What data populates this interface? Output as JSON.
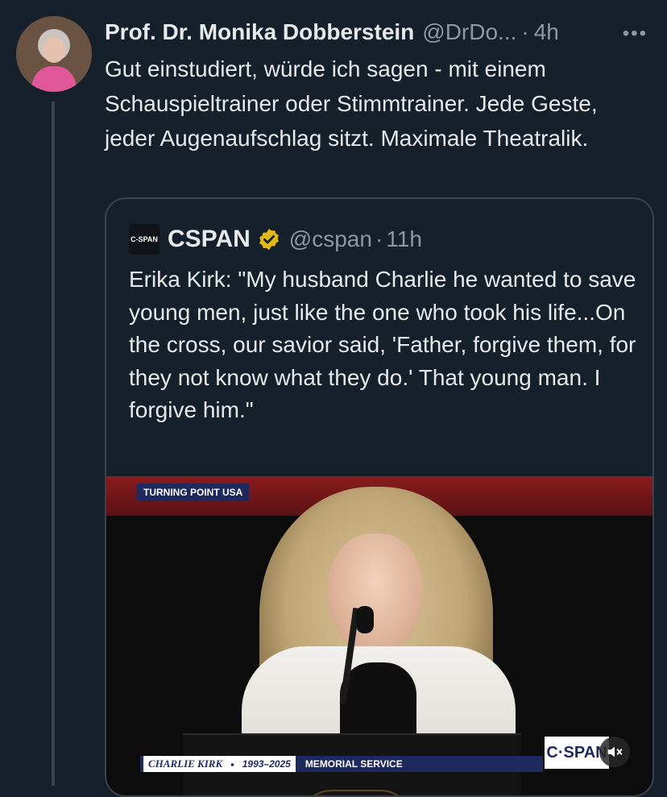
{
  "tweet": {
    "author_name": "Prof. Dr. Monika Dobberstein",
    "author_handle": "@DrDo...",
    "separator": "·",
    "time": "4h",
    "more_icon": "more-horizontal-icon",
    "text": "Gut einstudiert, würde ich sagen - mit einem Schauspieltrainer oder Stimmtrainer. Jede Geste, jeder Augenaufschlag sitzt. Maximale Theatralik."
  },
  "quote": {
    "avatar_text": "C-SPAN",
    "name": "CSPAN",
    "verified_icon": "verified-gold-badge-icon",
    "handle": "@cspan",
    "separator": "·",
    "time": "11h",
    "text": "Erika Kirk: \"My husband Charlie he wanted to save young men, just like the one who took his life...On the cross, our savior said, 'Father, forgive them, for they not know what they do.' That young man. I forgive him.\""
  },
  "media": {
    "top_badge": "TURNING POINT USA",
    "lower_third_name": "CHARLIE KIRK",
    "lower_third_sep": "▪",
    "lower_third_years": "1993–2025",
    "lower_third_event": "MEMORIAL SERVICE",
    "logo_text": "C·SPAN",
    "mute_icon": "speaker-muted-icon"
  },
  "colors": {
    "background": "#15202b",
    "text": "#e7e9ea",
    "muted": "#8b98a5",
    "border": "#38444d",
    "verified": "#e2b719"
  }
}
